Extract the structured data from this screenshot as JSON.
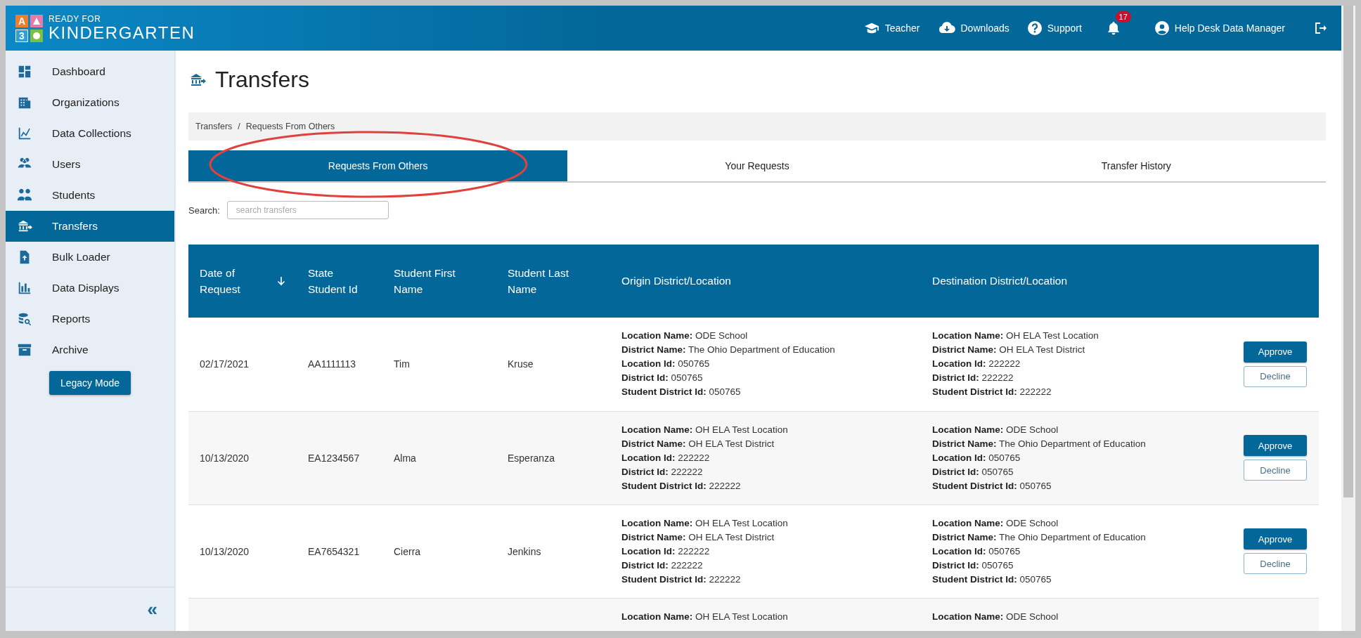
{
  "header": {
    "logo_letters": [
      "A",
      "3"
    ],
    "logo_top": "READY FOR",
    "logo_bottom": "KINDERGARTEN",
    "nav": [
      {
        "label": "Teacher"
      },
      {
        "label": "Downloads"
      },
      {
        "label": "Support"
      }
    ],
    "notifications": "17",
    "user": "Help Desk Data Manager"
  },
  "sidebar": {
    "items": [
      {
        "label": "Dashboard",
        "selected": false
      },
      {
        "label": "Organizations",
        "selected": false
      },
      {
        "label": "Data Collections",
        "selected": false
      },
      {
        "label": "Users",
        "selected": false
      },
      {
        "label": "Students",
        "selected": false
      },
      {
        "label": "Transfers",
        "selected": true
      },
      {
        "label": "Bulk Loader",
        "selected": false
      },
      {
        "label": "Data Displays",
        "selected": false
      },
      {
        "label": "Reports",
        "selected": false
      },
      {
        "label": "Archive",
        "selected": false
      }
    ],
    "legacy_button": "Legacy Mode",
    "collapse": "«"
  },
  "page": {
    "title": "Transfers",
    "breadcrumb": [
      "Transfers",
      "Requests From Others"
    ],
    "separator": "/"
  },
  "tabs": [
    {
      "label": "Requests From Others",
      "selected": true
    },
    {
      "label": "Your Requests",
      "selected": false
    },
    {
      "label": "Transfer History",
      "selected": false
    }
  ],
  "search": {
    "label": "Search:",
    "placeholder": "search transfers"
  },
  "annotation": {
    "kind": "ellipse",
    "color": "#e0413c"
  },
  "table": {
    "columns": [
      {
        "label": "Date of Request",
        "sorted": true
      },
      {
        "label": "State Student Id",
        "sorted": false
      },
      {
        "label": "Student First Name",
        "sorted": false
      },
      {
        "label": "Student Last Name",
        "sorted": false
      },
      {
        "label": "Origin District/Location",
        "sorted": false
      },
      {
        "label": "Destination District/Location",
        "sorted": false
      }
    ],
    "rows": [
      {
        "date": "02/17/2021",
        "state_id": "AA1111113",
        "first_name": "Tim",
        "last_name": "Kruse",
        "origin": [
          "**Location Name:** ODE School",
          "**District Name:** The Ohio Department of Education",
          "**Location Id:** 050765",
          "**District Id:** 050765",
          "**Student District Id:** 050765"
        ],
        "destination": [
          "**Location Name:** OH ELA Test Location",
          "**District Name:** OH ELA Test District",
          "**Location Id:** 222222",
          "**District Id:** 222222",
          "**Student District Id:** 222222"
        ],
        "actions": [
          "Approve",
          "Decline"
        ]
      },
      {
        "date": "10/13/2020",
        "state_id": "EA1234567",
        "first_name": "Alma",
        "last_name": "Esperanza",
        "origin": [
          "**Location Name:** OH ELA Test Location",
          "**District Name:** OH ELA Test District",
          "**Location Id:** 222222",
          "**District Id:** 222222",
          "**Student District Id:** 222222"
        ],
        "destination": [
          "**Location Name:** ODE School",
          "**District Name:** The Ohio Department of Education",
          "**Location Id:** 050765",
          "**District Id:** 050765",
          "**Student District Id:** 050765"
        ],
        "actions": [
          "Approve",
          "Decline"
        ]
      },
      {
        "date": "10/13/2020",
        "state_id": "EA7654321",
        "first_name": "Cierra",
        "last_name": "Jenkins",
        "origin": [
          "**Location Name:** OH ELA Test Location",
          "**District Name:** OH ELA Test District",
          "**Location Id:** 222222",
          "**District Id:** 222222",
          "**Student District Id:** 222222"
        ],
        "destination": [
          "**Location Name:** ODE School",
          "**District Name:** The Ohio Department of Education",
          "**Location Id:** 050765",
          "**District Id:** 050765",
          "**Student District Id:** 050765"
        ],
        "actions": [
          "Approve",
          "Decline"
        ]
      },
      {
        "origin": [
          "**Location Name:** OH ELA Test Location"
        ],
        "destination": [
          "**Location Name:** ODE School"
        ]
      }
    ]
  }
}
